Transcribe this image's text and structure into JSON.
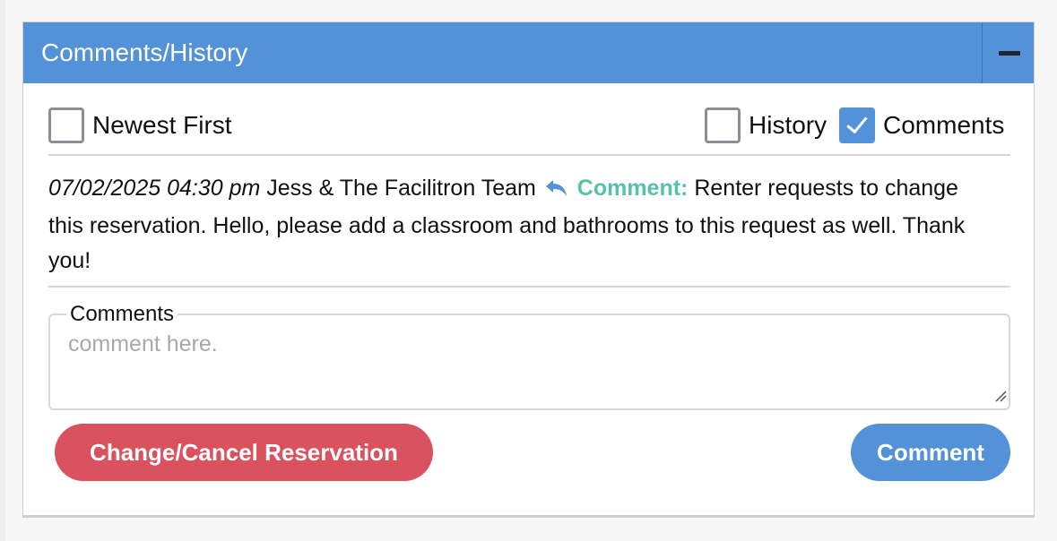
{
  "panel": {
    "title": "Comments/History",
    "collapse_icon": "minus-icon"
  },
  "filters": {
    "newest_first": {
      "label": "Newest First",
      "checked": false
    },
    "history": {
      "label": "History",
      "checked": false
    },
    "comments": {
      "label": "Comments",
      "checked": true
    }
  },
  "entries": [
    {
      "timestamp": "07/02/2025 04:30 pm",
      "author": "Jess & The Facilitron Team",
      "icon": "reply-icon",
      "type": "Comment:",
      "text": "Renter requests to change this reservation. Hello, please add a classroom and bathrooms to this request as well. Thank you!"
    }
  ],
  "comment_box": {
    "legend": "Comments",
    "placeholder": "comment here.",
    "value": ""
  },
  "actions": {
    "change_cancel_label": "Change/Cancel Reservation",
    "comment_label": "Comment"
  },
  "colors": {
    "header": "#5492d7",
    "accent_green": "#56c2a8",
    "danger": "#d9525e",
    "primary": "#5492d7"
  }
}
